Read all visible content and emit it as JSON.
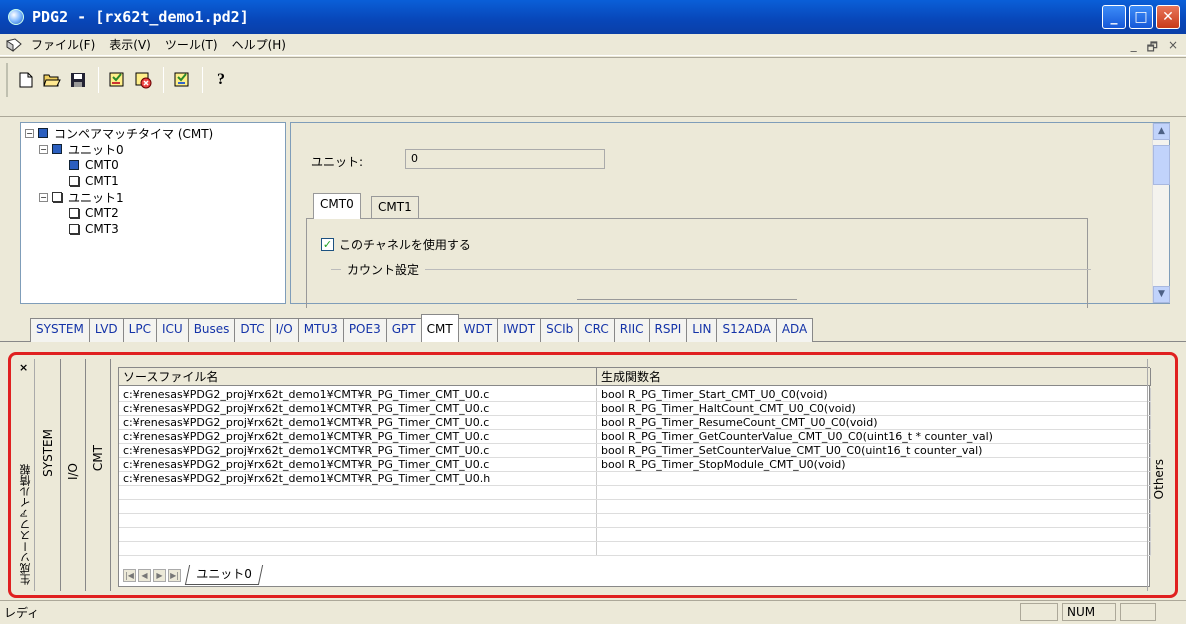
{
  "window": {
    "title": "PDG2 - [rx62t_demo1.pd2]"
  },
  "menu": {
    "items": [
      "ファイル(F)",
      "表示(V)",
      "ツール(T)",
      "ヘルプ(H)"
    ],
    "mdi_controls": [
      "_",
      "🗗",
      "×"
    ]
  },
  "toolbar": {
    "buttons": [
      "new-icon",
      "open-icon",
      "save-icon",
      "generate-icon",
      "check-icon",
      "report-icon",
      "help-icon"
    ]
  },
  "tree": {
    "root": "コンペアマッチタイマ (CMT)",
    "unit0": "ユニット0",
    "cmt0": "CMT0",
    "cmt1": "CMT1",
    "unit1": "ユニット1",
    "cmt2": "CMT2",
    "cmt3": "CMT3"
  },
  "settings": {
    "unit_label": "ユニット:",
    "unit_value": "0",
    "tabs": [
      "CMT0",
      "CMT1"
    ],
    "use_channel": "このチャネルを使用する",
    "count_group": "カウント設定"
  },
  "peripheral_tabs": [
    "SYSTEM",
    "LVD",
    "LPC",
    "ICU",
    "Buses",
    "DTC",
    "I/O",
    "MTU3",
    "POE3",
    "GPT",
    "CMT",
    "WDT",
    "IWDT",
    "SCIb",
    "CRC",
    "RIIC",
    "RSPI",
    "LIN",
    "S12ADA",
    "ADA"
  ],
  "active_tab": "CMT",
  "bottom_panel": {
    "close": "×",
    "side_title": "生成ソースファイル情報",
    "vertical_tabs": [
      "SYSTEM",
      "I/O",
      "CMT"
    ],
    "others": "Others",
    "columns": [
      "ソースファイル名",
      "生成関数名"
    ],
    "rows": [
      [
        "c:¥renesas¥PDG2_proj¥rx62t_demo1¥CMT¥R_PG_Timer_CMT_U0.c",
        "bool R_PG_Timer_Start_CMT_U0_C0(void)"
      ],
      [
        "c:¥renesas¥PDG2_proj¥rx62t_demo1¥CMT¥R_PG_Timer_CMT_U0.c",
        "bool R_PG_Timer_HaltCount_CMT_U0_C0(void)"
      ],
      [
        "c:¥renesas¥PDG2_proj¥rx62t_demo1¥CMT¥R_PG_Timer_CMT_U0.c",
        "bool R_PG_Timer_ResumeCount_CMT_U0_C0(void)"
      ],
      [
        "c:¥renesas¥PDG2_proj¥rx62t_demo1¥CMT¥R_PG_Timer_CMT_U0.c",
        "bool R_PG_Timer_GetCounterValue_CMT_U0_C0(uint16_t * counter_val)"
      ],
      [
        "c:¥renesas¥PDG2_proj¥rx62t_demo1¥CMT¥R_PG_Timer_CMT_U0.c",
        "bool R_PG_Timer_SetCounterValue_CMT_U0_C0(uint16_t counter_val)"
      ],
      [
        "c:¥renesas¥PDG2_proj¥rx62t_demo1¥CMT¥R_PG_Timer_CMT_U0.c",
        "bool R_PG_Timer_StopModule_CMT_U0(void)"
      ],
      [
        "c:¥renesas¥PDG2_proj¥rx62t_demo1¥CMT¥R_PG_Timer_CMT_U0.h",
        ""
      ]
    ],
    "sheet_tab": "ユニット0"
  },
  "status": {
    "text": "レディ",
    "num": "NUM"
  }
}
